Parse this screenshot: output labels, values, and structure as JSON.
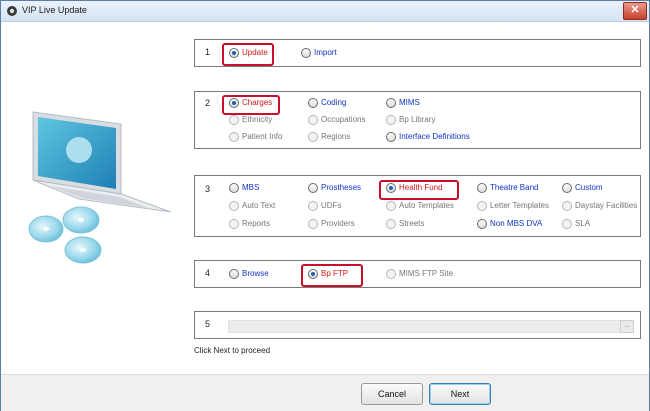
{
  "window": {
    "title": "VIP Live Update",
    "close": "✕"
  },
  "section1": {
    "num": "1",
    "options": [
      {
        "label": "Update",
        "checked": true,
        "style": "red"
      },
      {
        "label": "Import",
        "checked": false,
        "style": "blue"
      }
    ]
  },
  "section2": {
    "num": "2",
    "options": [
      {
        "label": "Charges",
        "checked": true,
        "style": "red"
      },
      {
        "label": "Coding",
        "checked": false,
        "style": "blue"
      },
      {
        "label": "MIMS",
        "checked": false,
        "style": "blue"
      },
      {
        "label": "Ethnicity",
        "checked": false,
        "style": "gray"
      },
      {
        "label": "Occupations",
        "checked": false,
        "style": "gray"
      },
      {
        "label": "Bp Library",
        "checked": false,
        "style": "gray"
      },
      {
        "label": "Patient Info",
        "checked": false,
        "style": "gray"
      },
      {
        "label": "Regions",
        "checked": false,
        "style": "gray"
      },
      {
        "label": "Interface Definitions",
        "checked": false,
        "style": "blue"
      }
    ]
  },
  "section3": {
    "num": "3",
    "options": [
      {
        "label": "MBS",
        "checked": false,
        "style": "blue"
      },
      {
        "label": "Prostheses",
        "checked": false,
        "style": "blue"
      },
      {
        "label": "Health Fund",
        "checked": true,
        "style": "red"
      },
      {
        "label": "Theatre Band",
        "checked": false,
        "style": "blue"
      },
      {
        "label": "Custom",
        "checked": false,
        "style": "blue"
      },
      {
        "label": "Auto Text",
        "checked": false,
        "style": "gray"
      },
      {
        "label": "UDFs",
        "checked": false,
        "style": "gray"
      },
      {
        "label": "Auto Templates",
        "checked": false,
        "style": "gray"
      },
      {
        "label": "Letter Templates",
        "checked": false,
        "style": "gray"
      },
      {
        "label": "Daystay Facilities",
        "checked": false,
        "style": "gray"
      },
      {
        "label": "Reports",
        "checked": false,
        "style": "gray"
      },
      {
        "label": "Providers",
        "checked": false,
        "style": "gray"
      },
      {
        "label": "Streets",
        "checked": false,
        "style": "gray"
      },
      {
        "label": "Non MBS DVA",
        "checked": false,
        "style": "blue"
      },
      {
        "label": "SLA",
        "checked": false,
        "style": "gray"
      }
    ]
  },
  "section4": {
    "num": "4",
    "options": [
      {
        "label": "Browse",
        "checked": false,
        "style": "blue"
      },
      {
        "label": "Bp FTP",
        "checked": true,
        "style": "red"
      },
      {
        "label": "MIMS FTP Site",
        "checked": false,
        "style": "gray"
      }
    ]
  },
  "section5": {
    "num": "5",
    "progress": 0,
    "ellipsis": "..."
  },
  "hint": "Click Next to proceed",
  "footer": {
    "cancel": "Cancel",
    "next": "Next"
  },
  "colors": {
    "accent_blue": "#1034c7",
    "selected_red": "#d01818",
    "highlight_border": "#c8102e",
    "disabled_gray": "#767676"
  }
}
